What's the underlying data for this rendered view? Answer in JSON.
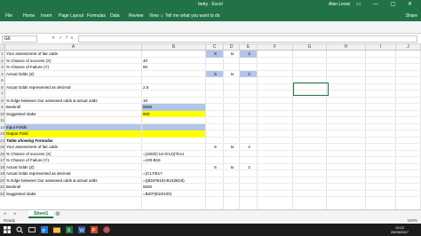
{
  "window": {
    "title": "betty  -  Excel",
    "user": "Alan Lewis",
    "controls": "▭ — ▢ ✕"
  },
  "ribbon": {
    "tabs": [
      "File",
      "Home",
      "Insert",
      "Page Layout",
      "Formulas",
      "Data",
      "Review",
      "View"
    ],
    "tell_me": "Tell me what you want to do",
    "share": "Share"
  },
  "formula_bar": {
    "name_box": "G6",
    "value": ""
  },
  "columns": [
    "A",
    "B",
    "C",
    "D",
    "E",
    "F",
    "G",
    "H",
    "I",
    "J"
  ],
  "rows": [
    "1",
    "2",
    "3",
    "4",
    "5",
    "6",
    "7",
    "8",
    "9",
    "10",
    "11",
    "12",
    "13",
    "14",
    "15",
    "16",
    "17",
    "18",
    "19",
    "20",
    "21",
    "22"
  ],
  "cells": {
    "A1": "Your assessment of fair odds",
    "C1": "6",
    "D1": "to",
    "E1": "4",
    "A2": "% Chance of success (X)",
    "B2": "40",
    "A3": "% Chance of Failure (Y)",
    "B3": "60",
    "A4": "Actual Odds (Z)",
    "C4": "5",
    "D4": "to",
    "E4": "2",
    "A6": "Actual Odds represented as decimal",
    "B6": "2.5",
    "A8": "% Edge between Our assessed odds & actual odds",
    "B8": "16",
    "A9": "Bankroll",
    "B9": "5000",
    "A10": "Suggested stake",
    "B10": "800",
    "A12": "Input Fields",
    "A13": "Output Field",
    "A14": "Table showing Formulas",
    "A15": "Your assessment of fair odds",
    "C15": "6",
    "D15": "to",
    "E15": "4",
    "A16": "% Chance of success (X)",
    "B16": "=(100/(C14+E14))*E14",
    "A17": "% Chance of Failure (Y)",
    "B17": "=100-B15",
    "A18": "Actual Odds (Z)",
    "C18": "5",
    "D18": "to",
    "E18": "2",
    "A19": "Actual Odds represented as decimal",
    "B19": "=(C17/E17",
    "A20": "% Edge between Our assessed odds & actual odds",
    "B20": "=((B15*B18)-B16)/B18)",
    "A21": "Bankroll",
    "B21": "5000",
    "A22": "Suggested stake",
    "B22": "=B20*(B19/100)"
  },
  "sheet_tabs": [
    "Sheet1"
  ],
  "status": {
    "ready": "Ready",
    "zoom": "100%"
  },
  "taskbar": {
    "time": "10:22",
    "date": "25/05/2017"
  },
  "colors": {
    "accent": "#217346",
    "input_fill": "#b4c6e7",
    "output_fill": "#ffff00"
  }
}
